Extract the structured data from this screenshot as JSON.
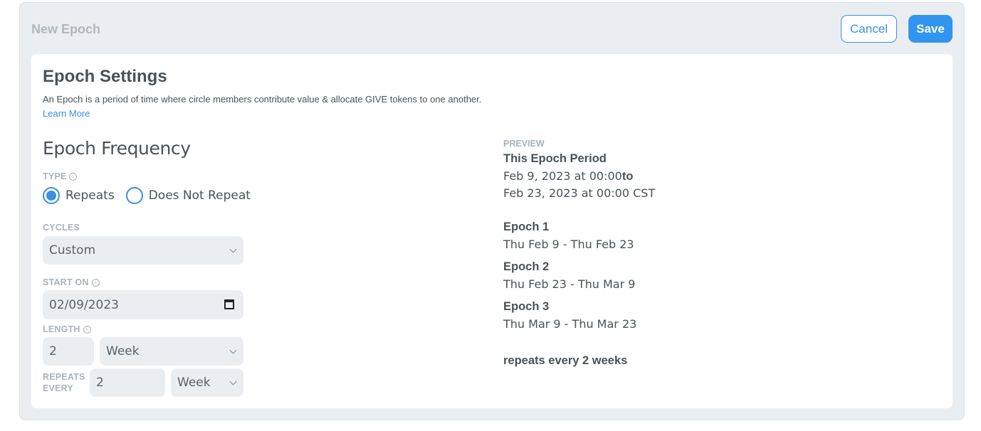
{
  "header": {
    "title": "New Epoch",
    "cancel_label": "Cancel",
    "save_label": "Save"
  },
  "settings": {
    "title": "Epoch Settings",
    "description": "An Epoch is a period of time where circle members contribute value & allocate GIVE tokens to one another.",
    "learn_more": "Learn More"
  },
  "frequency": {
    "title": "Epoch Frequency",
    "type_label": "TYPE",
    "options": [
      "Repeats",
      "Does Not Repeat"
    ],
    "selected": "Repeats",
    "cycles_label": "CYCLES",
    "cycles_value": "Custom",
    "start_label": "START ON",
    "start_value": "02/09/2023",
    "length_label": "LENGTH",
    "length_value": "2",
    "length_unit": "Week",
    "repeats_label_1": "REPEATS",
    "repeats_label_2": "EVERY",
    "repeats_value": "2",
    "repeats_unit": "Week"
  },
  "preview": {
    "label": "PREVIEW",
    "period_title": "This Epoch Period",
    "period_start": "Feb 9, 2023 at 00:00",
    "period_to": "to",
    "period_end": "Feb 23, 2023 at 00:00 CST",
    "epochs": [
      {
        "name": "Epoch 1",
        "range": "Thu Feb 9 - Thu Feb 23"
      },
      {
        "name": "Epoch 2",
        "range": "Thu Feb 23 - Thu Mar 9"
      },
      {
        "name": "Epoch 3",
        "range": "Thu Mar 9 - Thu Mar 23"
      }
    ],
    "summary": "repeats every 2 weeks"
  },
  "colors": {
    "accent": "#3194ee",
    "panel_bg": "#ebeef1",
    "text": "#4a5257",
    "muted": "#aab3b9"
  },
  "icons": [
    "info-icon",
    "chevron-down-icon",
    "calendar-icon"
  ]
}
